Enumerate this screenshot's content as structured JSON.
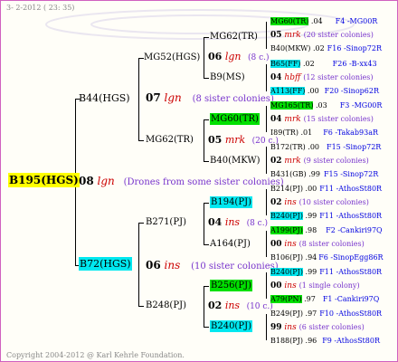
{
  "header": {
    "date": "3-  2-2012 ( 23: 35)"
  },
  "footer": {
    "copyright": "Copyright 2004-2012 @ Karl Kehrle Foundation."
  },
  "root": {
    "id": "B195(HGS)",
    "year": "08",
    "line": "lgn",
    "note": "(Drones from some sister colonies)"
  },
  "gen1": {
    "top": {
      "id": "B44(HGS)",
      "year": "07",
      "line": "lgn",
      "note": "(8 sister colonies)"
    },
    "bottom": {
      "id": "B72(HGS)",
      "year": "06",
      "line": "ins",
      "note": "(10 sister colonies)"
    }
  },
  "gen2": {
    "a": {
      "id": "MG52(HGS)",
      "year": "06",
      "line": "lgn",
      "note": "(8 c.)"
    },
    "b": {
      "id": "MG62(TR)",
      "year": "05",
      "line": "mrk",
      "note": "(20 c.)"
    },
    "c": {
      "id": "B271(PJ)",
      "year": "04",
      "line": "ins",
      "note": "(8 c.)"
    },
    "d": {
      "id": "B248(PJ)",
      "year": "02",
      "line": "ins",
      "note": "(10 c.)"
    }
  },
  "gen3": {
    "a1": "MG62(TR)",
    "a2": "B9(MS)",
    "b1": "MG60(TR)",
    "b2": "B40(MKW)",
    "c1": "B194(PJ)",
    "c2": "A164(PJ)",
    "d1": "B256(PJ)",
    "d2": "B240(PJ)"
  },
  "gen4": [
    {
      "pre": "MG60(TR)",
      "mid": " .04",
      "post": "F4 -MG00R"
    },
    {
      "pre": "05",
      "mid": "mrk",
      "post": "(20 sister colonies)"
    },
    {
      "pre": "B40(MKW)",
      "mid": " .02",
      "post": "F16 -Sinop72R"
    },
    {
      "pre": "B65(FF)",
      "mid": " .02",
      "post": "F26 -B-xx43"
    },
    {
      "pre": "04",
      "mid": "hbff",
      "post": "(12 sister colonies)"
    },
    {
      "pre": "A113(FF)",
      "mid": " .00",
      "post": "F20 -Sinop62R"
    },
    {
      "pre": "MG165(TR)",
      "mid": " .03",
      "post": "F3 -MG00R"
    },
    {
      "pre": "04",
      "mid": "mrk",
      "post": "(15 sister colonies)"
    },
    {
      "pre": "I89(TR)",
      "mid": " .01",
      "post": "F6 -Takab93aR"
    },
    {
      "pre": "B172(TR)",
      "mid": " .00",
      "post": "F15 -Sinop72R"
    },
    {
      "pre": "02",
      "mid": "mrk",
      "post": "(9 sister colonies)"
    },
    {
      "pre": "B431(GB)",
      "mid": " .99",
      "post": "F15 -Sinop72R"
    },
    {
      "pre": "B214(PJ)",
      "mid": " .00",
      "post": "F11 -AthosSt80R"
    },
    {
      "pre": "02",
      "mid": "ins",
      "post": "(10 sister colonies)"
    },
    {
      "pre": "B240(PJ)",
      "mid": " .99",
      "post": "F11 -AthosSt80R"
    },
    {
      "pre": "A199(PJ)",
      "mid": " .98",
      "post": "F2 -Cankiri97Q"
    },
    {
      "pre": "00",
      "mid": "ins",
      "post": "(8 sister colonies)"
    },
    {
      "pre": "B106(PJ)",
      "mid": " .94",
      "post": "F6 -SinopEgg86R"
    },
    {
      "pre": "B240(PJ)",
      "mid": " .99",
      "post": "F11 -AthosSt80R"
    },
    {
      "pre": "00",
      "mid": "ins",
      "post": "(1 single colony)"
    },
    {
      "pre": "A79(PN)",
      "mid": " .97",
      "post": "F1 -Cankiri97Q"
    },
    {
      "pre": "B249(PJ)",
      "mid": " .97",
      "post": "F10 -AthosSt80R"
    },
    {
      "pre": "99",
      "mid": "ins",
      "post": "(6 sister colonies)"
    },
    {
      "pre": "B188(PJ)",
      "mid": " .96",
      "post": "F9 -AthosSt80R"
    }
  ],
  "colors": {
    "green": "#00e000",
    "cyan": "#00e8f0",
    "yellow": "#ffff00",
    "frame": "#d060c0",
    "link": "#0000e0",
    "line": "#cc0000",
    "note": "#7733cc"
  }
}
